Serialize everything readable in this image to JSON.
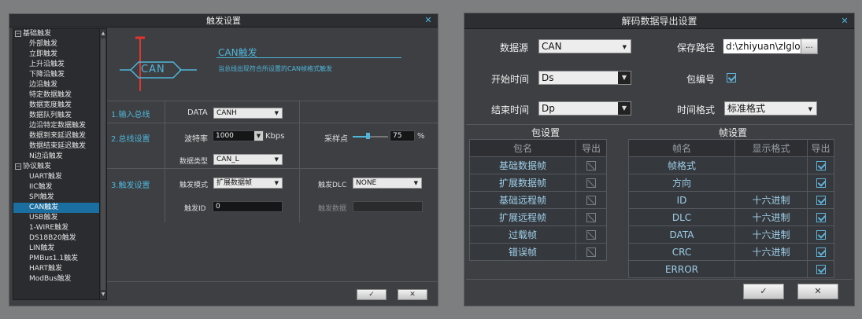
{
  "trigger_dialog": {
    "title": "触发设置",
    "close": "✕",
    "tree": [
      {
        "label": "基础触发",
        "level": 0,
        "expander": "−"
      },
      {
        "label": "外部触发",
        "level": 1
      },
      {
        "label": "立即触发",
        "level": 1
      },
      {
        "label": "上升沿触发",
        "level": 1
      },
      {
        "label": "下降沿触发",
        "level": 1
      },
      {
        "label": "边沿触发",
        "level": 1
      },
      {
        "label": "特定数据触发",
        "level": 1
      },
      {
        "label": "数据宽度触发",
        "level": 1
      },
      {
        "label": "数据队列触发",
        "level": 1
      },
      {
        "label": "边沿特定数据触发",
        "level": 1
      },
      {
        "label": "数据到来延迟触发",
        "level": 1
      },
      {
        "label": "数据结束延迟触发",
        "level": 1
      },
      {
        "label": "N边沿触发",
        "level": 1
      },
      {
        "label": "协议触发",
        "level": 0,
        "expander": "−"
      },
      {
        "label": "UART触发",
        "level": 1
      },
      {
        "label": "IIC触发",
        "level": 1
      },
      {
        "label": "SPI触发",
        "level": 1
      },
      {
        "label": "CAN触发",
        "level": 1,
        "selected": true
      },
      {
        "label": "USB触发",
        "level": 1
      },
      {
        "label": "1-WIRE触发",
        "level": 1
      },
      {
        "label": "DS18B20触发",
        "level": 1
      },
      {
        "label": "LIN触发",
        "level": 1
      },
      {
        "label": "PMBus1.1触发",
        "level": 1
      },
      {
        "label": "HART触发",
        "level": 1
      },
      {
        "label": "ModBus触发",
        "level": 1
      }
    ],
    "logo_text": "CAN",
    "heading": "CAN触发",
    "description": "当总线出现符合所设置的CAN帧格式触发",
    "sections": {
      "input_bus": "1.输入总线",
      "bus_settings": "2.总线设置",
      "trigger_settings": "3.触发设置"
    },
    "data_label": "DATA",
    "data_value": "CANH",
    "baud_label": "波特率",
    "baud_value": "1000",
    "baud_unit": "Kbps",
    "sample_label": "采样点",
    "sample_value": "75",
    "sample_unit": "%",
    "sample_fraction": 0.75,
    "data_type_label": "数据类型",
    "data_type_value": "CAN_L",
    "trigger_mode_label": "触发模式",
    "trigger_mode_value": "扩展数据帧",
    "trigger_dlc_label": "触发DLC",
    "trigger_dlc_value": "NONE",
    "trigger_id_label": "触发ID",
    "trigger_id_value": "0",
    "trigger_data_label": "触发数据",
    "trigger_data_value": "",
    "ok": "✓",
    "cancel": "✕"
  },
  "export_dialog": {
    "title": "解码数据导出设置",
    "close": "✕",
    "source_label": "数据源",
    "source_value": "CAN",
    "save_path_label": "保存路径",
    "save_path_value": "d:\\zhiyuan\\zlglog",
    "browse": "...",
    "start_label": "开始时间",
    "start_value": "Ds",
    "packet_no_label": "包编号",
    "packet_no_checked": true,
    "end_label": "结束时间",
    "end_value": "Dp",
    "time_format_label": "时间格式",
    "time_format_value": "标准格式",
    "packet_settings_title": "包设置",
    "frame_settings_title": "帧设置",
    "packet_headers": [
      "包名",
      "导出"
    ],
    "packet_rows": [
      "基础数据帧",
      "扩展数据帧",
      "基础远程帧",
      "扩展远程帧",
      "过载帧",
      "错误帧"
    ],
    "frame_headers": [
      "帧名",
      "显示格式",
      "导出"
    ],
    "frame_rows": [
      {
        "name": "帧格式",
        "format": ""
      },
      {
        "name": "方向",
        "format": ""
      },
      {
        "name": "ID",
        "format": "十六进制"
      },
      {
        "name": "DLC",
        "format": "十六进制"
      },
      {
        "name": "DATA",
        "format": "十六进制"
      },
      {
        "name": "CRC",
        "format": "十六进制"
      },
      {
        "name": "ERROR",
        "format": ""
      }
    ],
    "ok": "✓",
    "cancel": "✕"
  },
  "colors": {
    "accent": "#4fb5d9",
    "logo_red": "#e0352f",
    "selected": "#1b6ea0"
  }
}
